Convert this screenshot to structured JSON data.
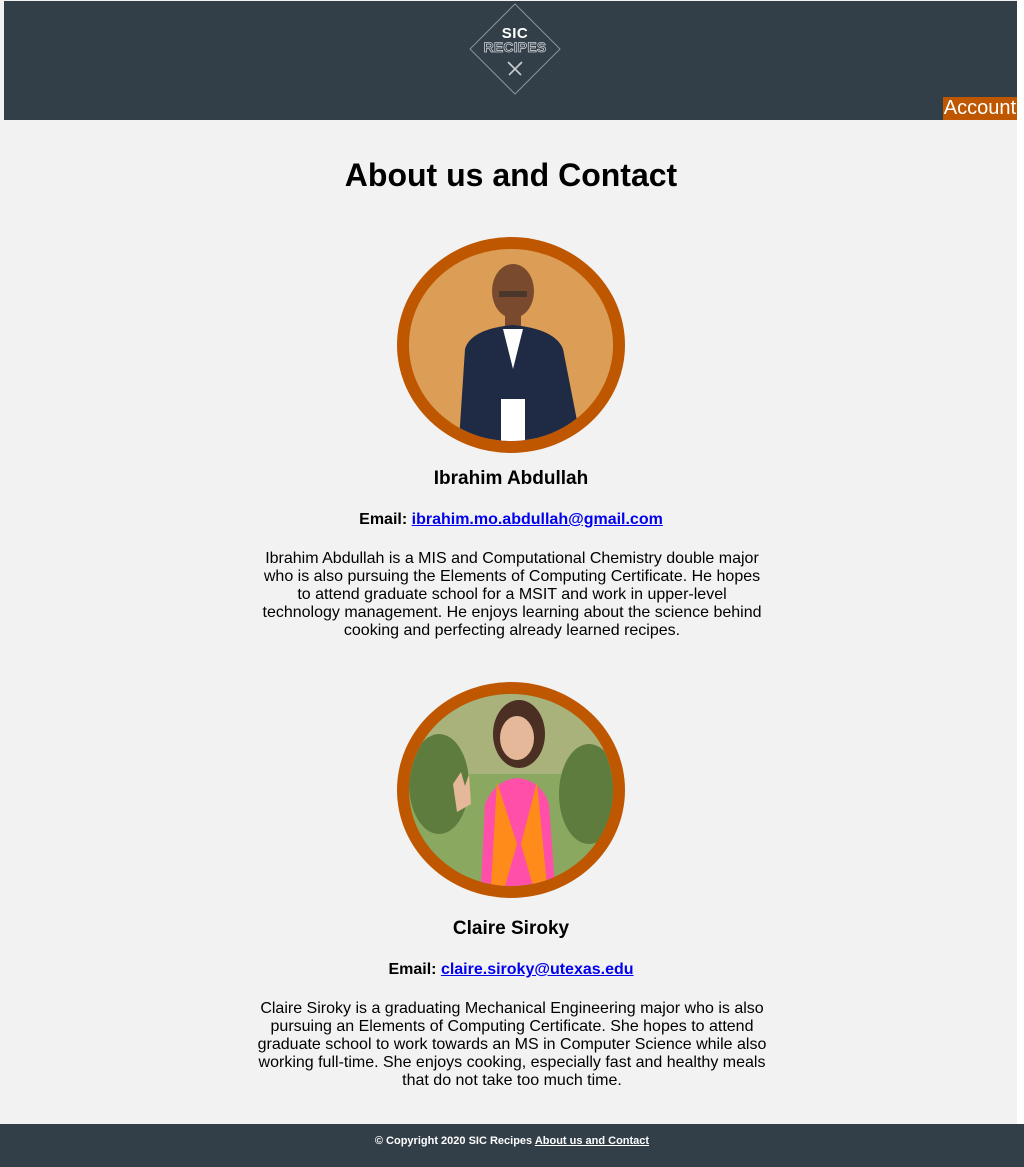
{
  "header": {
    "logo": {
      "line1": "SIC",
      "line2": "RECIPES",
      "icon": "fork-knife-icon"
    },
    "account_label": "Account"
  },
  "page_title": "About us and Contact",
  "people": [
    {
      "name": "Ibrahim Abdullah",
      "email_label": "Email:",
      "email": "ibrahim.mo.abdullah@gmail.com",
      "bio": "Ibrahim Abdullah is a MIS and Computational Chemistry double major who is also pursuing the Elements of Computing Certificate. He hopes to attend graduate school for a MSIT and work in upper-level technology management. He enjoys learning about the science behind cooking and perfecting already learned recipes."
    },
    {
      "name": "Claire Siroky",
      "email_label": "Email:",
      "email": "claire.siroky@utexas.edu",
      "bio": "Claire Siroky is a graduating Mechanical Engineering major who is also pursuing an Elements of Computing Certificate. She hopes to attend graduate school to work towards an MS in Computer Science while also working full-time. She enjoys cooking, especially fast and healthy meals that do not take too much time."
    }
  ],
  "footer": {
    "copyright": "© Copyright 2020 SIC Recipes",
    "link_label": "About us and Contact"
  },
  "colors": {
    "header_bg": "#323e48",
    "accent": "#bf5700",
    "page_bg": "#f2f2f2",
    "link": "#0000ee"
  }
}
